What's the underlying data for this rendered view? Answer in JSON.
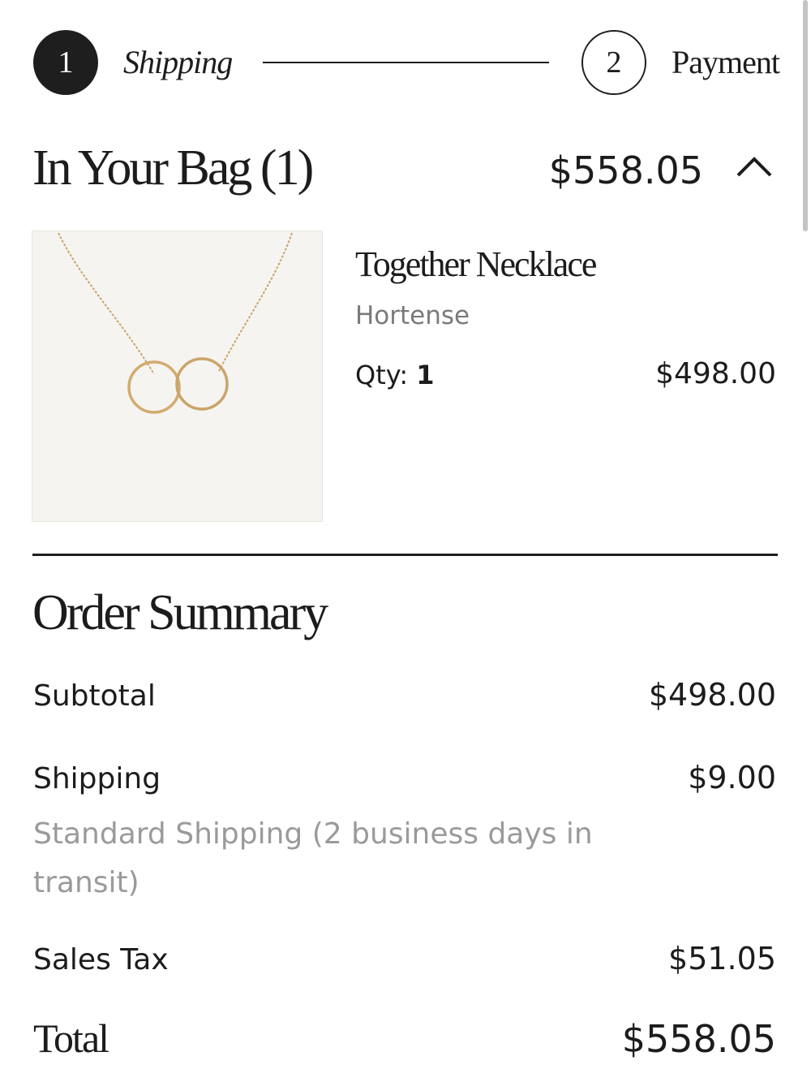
{
  "stepper": {
    "step1": {
      "number": "1",
      "label": "Shipping"
    },
    "step2": {
      "number": "2",
      "label": "Payment"
    }
  },
  "bag": {
    "title": "In Your Bag (1)",
    "total": "$558.05",
    "toggle_icon": "chevron-up-icon"
  },
  "product": {
    "name": "Together Necklace",
    "brand": "Hortense",
    "qty_label": "Qty:",
    "qty_value": "1",
    "price": "$498.00",
    "image_icon": "necklace-image"
  },
  "summary": {
    "title": "Order Summary",
    "subtotal_label": "Subtotal",
    "subtotal_value": "$498.00",
    "shipping_label": "Shipping",
    "shipping_value": "$9.00",
    "shipping_desc": "Standard Shipping (2 business days in transit)",
    "tax_label": "Sales Tax",
    "tax_value": "$51.05",
    "total_label": "Total",
    "total_value": "$558.05"
  },
  "colors": {
    "text": "#1c1c1c",
    "muted": "#7a7a7a",
    "light_muted": "#9a9a9a",
    "image_bg": "#f6f4f1",
    "gold": "#c9a56a"
  }
}
